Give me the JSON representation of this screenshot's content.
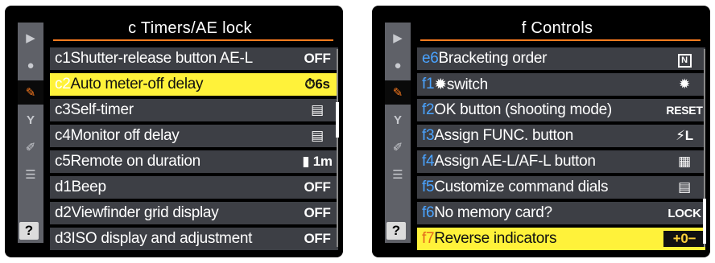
{
  "screens": [
    {
      "title": "c Timers/AE lock",
      "help": "?",
      "tabs": [
        "▶",
        "●",
        "✎",
        "Y",
        "✐",
        "☰"
      ],
      "rows": [
        {
          "code": "c1",
          "label": "Shutter-release button AE-L",
          "value": "OFF",
          "selected": false
        },
        {
          "code": "c2",
          "label": "Auto meter-off delay",
          "value": "⏱6s",
          "selected": true
        },
        {
          "code": "c3",
          "label": "Self-timer",
          "value": "▤",
          "selected": false
        },
        {
          "code": "c4",
          "label": "Monitor off delay",
          "value": "▤",
          "selected": false
        },
        {
          "code": "c5",
          "label": "Remote on duration",
          "value": "▮ 1m",
          "selected": false
        },
        {
          "code": "d1",
          "label": "Beep",
          "value": "OFF",
          "selected": false
        },
        {
          "code": "d2",
          "label": "Viewfinder grid display",
          "value": "OFF",
          "selected": false
        },
        {
          "code": "d3",
          "label": "ISO display and adjustment",
          "value": "OFF",
          "selected": false
        }
      ]
    },
    {
      "title": "f Controls",
      "help": "?",
      "tabs": [
        "▶",
        "●",
        "✎",
        "Y",
        "✐",
        "☰"
      ],
      "rows": [
        {
          "code": "e6",
          "label": "Bracketing order",
          "value": "N",
          "selected": false
        },
        {
          "code": "f1",
          "label": "✹switch",
          "value": "✹",
          "selected": false
        },
        {
          "code": "f2",
          "label": "OK button (shooting mode)",
          "value": "RESET",
          "selected": false
        },
        {
          "code": "f3",
          "label": "Assign FUNC. button",
          "value": "⚡L",
          "selected": false
        },
        {
          "code": "f4",
          "label": "Assign AE-L/AF-L button",
          "value": "▦",
          "selected": false
        },
        {
          "code": "f5",
          "label": "Customize command dials",
          "value": "▤",
          "selected": false
        },
        {
          "code": "f6",
          "label": "No memory card?",
          "value": "LOCK",
          "selected": false
        },
        {
          "code": "f7",
          "label": "Reverse indicators",
          "value": "+0−",
          "selected": true
        }
      ]
    }
  ]
}
